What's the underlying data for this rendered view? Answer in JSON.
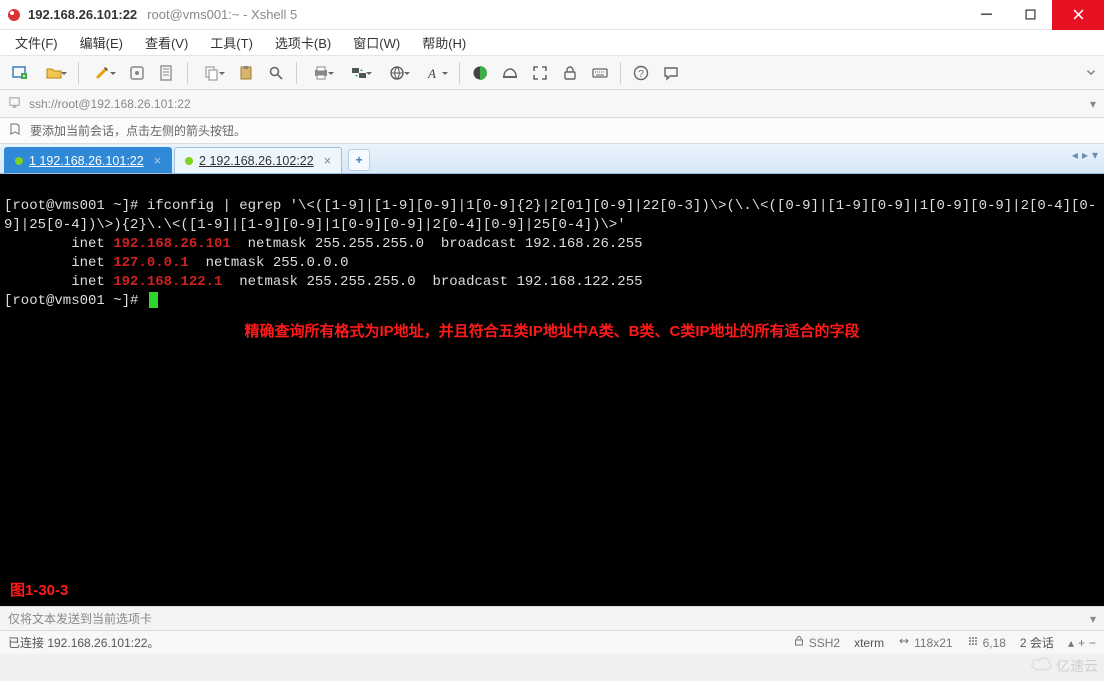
{
  "window": {
    "title_bold": "192.168.26.101:22",
    "title_rest": "root@vms001:~ - Xshell 5"
  },
  "menu": {
    "file": "文件(F)",
    "edit": "编辑(E)",
    "view": "查看(V)",
    "tools": "工具(T)",
    "tabs": "选项卡(B)",
    "window": "窗口(W)",
    "help": "帮助(H)"
  },
  "address": {
    "url": "ssh://root@192.168.26.101:22"
  },
  "hint": {
    "text": "要添加当前会话，点击左侧的箭头按钮。"
  },
  "tabs": {
    "items": [
      {
        "label": "1 192.168.26.101:22",
        "active": true
      },
      {
        "label": "2 192.168.26.102:22",
        "active": false
      }
    ]
  },
  "terminal": {
    "line_cmd_prefix": "[root@vms001 ~]# ",
    "line_cmd": "ifconfig | egrep '\\<([1-9]|[1-9][0-9]|1[0-9]{2}|2[01][0-9]|22[0-3])\\>(\\.\\<([0-9]|[1-9][0-9]|1[0-9][0-9]|2[0-4][0-9]|25[0-4])\\>){2}\\.\\<([1-9]|[1-9][0-9]|1[0-9][0-9]|2[0-4][0-9]|25[0-4])\\>'",
    "row1_pre": "        inet ",
    "row1_ip": "192.168.26.101",
    "row1_post": "  netmask 255.255.255.0  broadcast 192.168.26.255",
    "row2_pre": "        inet ",
    "row2_ip": "127.0.0.1",
    "row2_post": "  netmask 255.0.0.0",
    "row3_pre": "        inet ",
    "row3_ip": "192.168.122.1",
    "row3_post": "  netmask 255.255.255.0  broadcast 192.168.122.255",
    "prompt2": "[root@vms001 ~]# ",
    "annotation": "精确查询所有格式为IP地址，并且符合五类IP地址中A类、B类、C类IP地址的所有适合的字段",
    "figure": "图1-30-3"
  },
  "sendbar": {
    "text": "仅将文本发送到当前选项卡"
  },
  "status": {
    "conn": "已连接 192.168.26.101:22。",
    "proto": "SSH2",
    "term": "xterm",
    "size": "118x21",
    "pos": "6,18",
    "sess": "2 会话"
  },
  "watermark": "亿速云"
}
